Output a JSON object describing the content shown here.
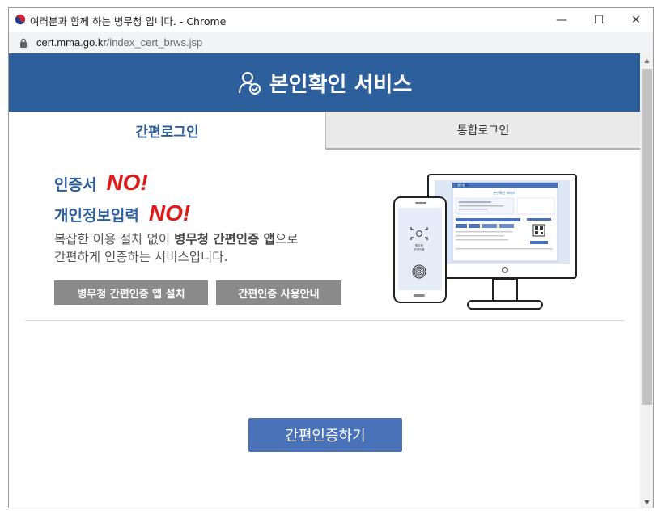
{
  "window": {
    "title": "여러분과 함께 하는 병무청 입니다. - Chrome",
    "minimize_glyph": "—",
    "maximize_glyph": "☐",
    "close_glyph": "✕"
  },
  "address_bar": {
    "host": "cert.mma.go.kr",
    "path": "/index_cert_brws.jsp",
    "lock_icon": "lock-icon"
  },
  "header": {
    "title": "본인확인 서비스",
    "icon": "user-check-icon",
    "bg_color": "#2c5f9c"
  },
  "tabs": [
    {
      "label": "간편로그인",
      "active": true
    },
    {
      "label": "통합로그인",
      "active": false
    }
  ],
  "slogans": [
    {
      "label": "인증서",
      "no": "NO!"
    },
    {
      "label": "개인정보입력",
      "no": "NO!"
    }
  ],
  "description": {
    "line1_pre": "복잡한 이용 절차 없이 ",
    "line1_bold": "병무청 간편인증 앱",
    "line1_post": "으로",
    "line2": "간편하게 인증하는 서비스입니다."
  },
  "buttons": {
    "install_app": "병무청 간편인증 앱 설치",
    "guide": "간편인증 사용안내",
    "authenticate": "간편인증하기"
  },
  "illustration": {
    "monitor_header": "병무청",
    "monitor_title": "본인확인 서비스",
    "phone_text_1": "병무청",
    "phone_text_2": "간편인증"
  },
  "colors": {
    "brand": "#2c5f9c",
    "accent_no": "#e01818",
    "primary_button": "#4a72b8",
    "gray_button": "#8a8a8a"
  }
}
